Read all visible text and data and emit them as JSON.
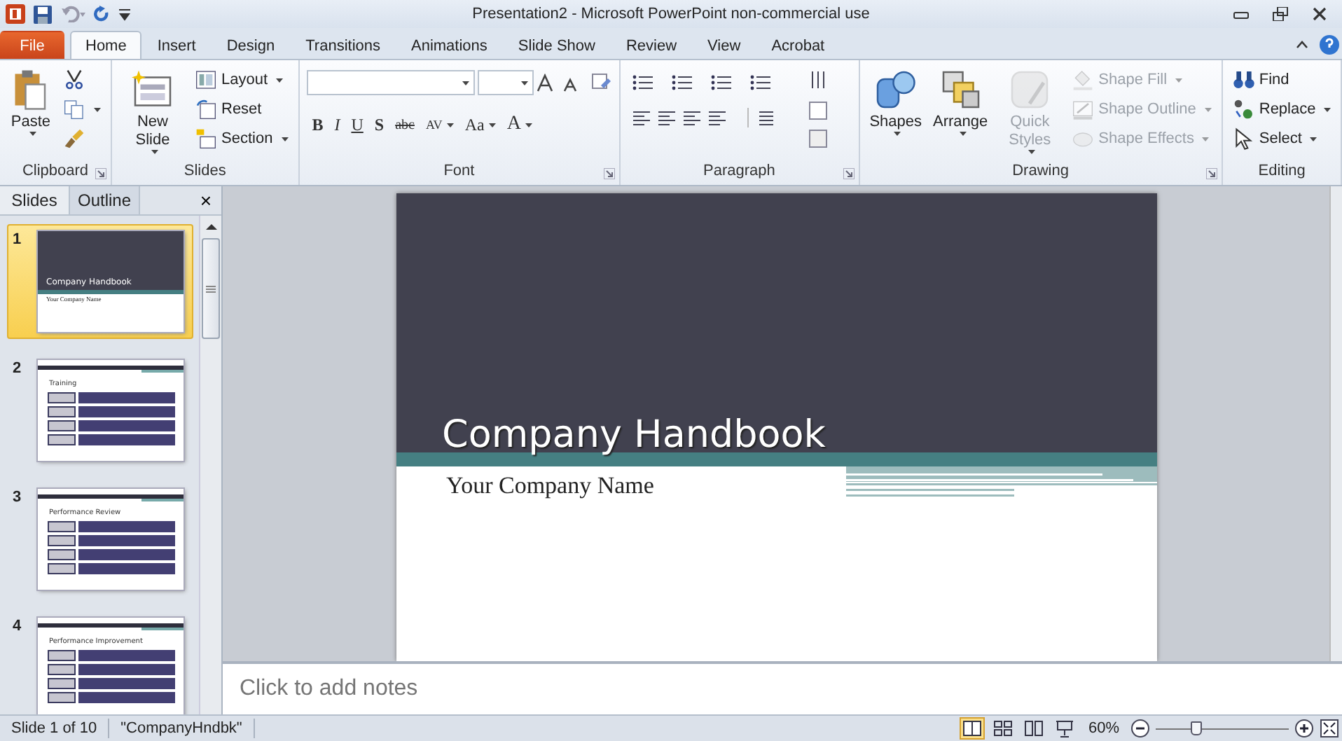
{
  "window": {
    "title": "Presentation2 - Microsoft PowerPoint non-commercial use"
  },
  "tabs": [
    {
      "label": "File",
      "kind": "file",
      "selected": false
    },
    {
      "label": "Home",
      "kind": "tab",
      "selected": true
    },
    {
      "label": "Insert",
      "kind": "tab",
      "selected": false
    },
    {
      "label": "Design",
      "kind": "tab",
      "selected": false
    },
    {
      "label": "Transitions",
      "kind": "tab",
      "selected": false
    },
    {
      "label": "Animations",
      "kind": "tab",
      "selected": false
    },
    {
      "label": "Slide Show",
      "kind": "tab",
      "selected": false
    },
    {
      "label": "Review",
      "kind": "tab",
      "selected": false
    },
    {
      "label": "View",
      "kind": "tab",
      "selected": false
    },
    {
      "label": "Acrobat",
      "kind": "tab",
      "selected": false
    }
  ],
  "ribbon": {
    "groups": [
      {
        "label": "Clipboard",
        "kind": "buttons",
        "launcher": true,
        "items": [
          {
            "label": "Paste",
            "kind": "large",
            "dropdown": true,
            "disabled": false
          },
          {
            "kind": "small",
            "dropdown": false,
            "disabled": false
          },
          {
            "kind": "small",
            "dropdown": true,
            "disabled": false
          },
          {
            "kind": "small",
            "dropdown": false,
            "disabled": false
          }
        ]
      },
      {
        "label": "Slides",
        "kind": "buttons",
        "launcher": false,
        "items": [
          {
            "label": "New Slide",
            "kind": "large",
            "dropdown": true,
            "disabled": false
          },
          {
            "label": "Layout",
            "kind": "small",
            "dropdown": true,
            "disabled": false
          },
          {
            "label": "Reset",
            "kind": "small",
            "dropdown": false,
            "disabled": false
          },
          {
            "label": "Section",
            "kind": "small",
            "dropdown": true,
            "disabled": false
          }
        ]
      },
      {
        "label": "Font",
        "kind": "font",
        "launcher": true,
        "format_buttons": [
          {
            "label": "B",
            "dropdown": false
          },
          {
            "label": "I",
            "dropdown": false
          },
          {
            "label": "U",
            "dropdown": false
          },
          {
            "label": "S",
            "dropdown": false
          },
          {
            "label": "abc",
            "dropdown": false
          },
          {
            "label": "AV",
            "dropdown": true
          },
          {
            "label": "Aa",
            "dropdown": true
          },
          {
            "label": "A",
            "dropdown": true
          }
        ]
      },
      {
        "label": "Paragraph",
        "kind": "paragraph",
        "launcher": true
      },
      {
        "label": "Drawing",
        "kind": "buttons",
        "launcher": true,
        "items": [
          {
            "label": "Shapes",
            "kind": "large",
            "dropdown": true,
            "disabled": false
          },
          {
            "label": "Arrange",
            "kind": "large",
            "dropdown": true,
            "disabled": false
          },
          {
            "label": "Quick Styles",
            "kind": "large",
            "dropdown": true,
            "disabled": true
          },
          {
            "label": "Shape Fill",
            "kind": "small",
            "dropdown": true,
            "disabled": true
          },
          {
            "label": "Shape Outline",
            "kind": "small",
            "dropdown": true,
            "disabled": true
          },
          {
            "label": "Shape Effects",
            "kind": "small",
            "dropdown": true,
            "disabled": true
          }
        ]
      },
      {
        "label": "Editing",
        "kind": "buttons",
        "launcher": false,
        "items": [
          {
            "label": "Find",
            "kind": "small",
            "dropdown": false,
            "disabled": false
          },
          {
            "label": "Replace",
            "kind": "small",
            "dropdown": true,
            "disabled": false
          },
          {
            "label": "Select",
            "kind": "small",
            "dropdown": true,
            "disabled": false
          }
        ]
      }
    ]
  },
  "panel": {
    "tabs": [
      {
        "label": "Slides",
        "selected": true
      },
      {
        "label": "Outline",
        "selected": false
      }
    ],
    "close": "×",
    "thumbnails": [
      {
        "number": "1",
        "kind": "title",
        "selected": true,
        "title": "Company Handbook",
        "subtitle": "Your Company Name"
      },
      {
        "number": "2",
        "kind": "list",
        "selected": false,
        "title": "Training"
      },
      {
        "number": "3",
        "kind": "list",
        "selected": false,
        "title": "Performance Review"
      },
      {
        "number": "4",
        "kind": "list",
        "selected": false,
        "title": "Performance Improvement"
      }
    ]
  },
  "slide": {
    "title": "Company Handbook",
    "subtitle": "Your Company Name"
  },
  "notes": {
    "placeholder": "Click to add notes"
  },
  "status_bar": {
    "slide": "Slide 1 of 10",
    "theme": "\"CompanyHndbk\"",
    "views": [
      {
        "selected": true
      },
      {
        "selected": false
      },
      {
        "selected": false
      },
      {
        "selected": false
      }
    ],
    "zoom": "60%",
    "zoom_slider": {
      "level": 0.3
    }
  }
}
